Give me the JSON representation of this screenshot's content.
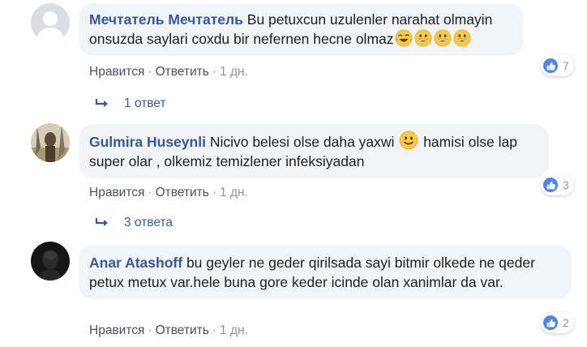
{
  "comments": [
    {
      "author": "Мечтатель Мечтатель",
      "text": "Bu petuxcun uzulenler narahat olmayin onsuzda saylari coxdu bir nefernen hecne olmaz",
      "emojis": [
        "tears-of-joy-emoji",
        "grinning-emoji",
        "grinning-emoji",
        "grinning-emoji"
      ],
      "actions": {
        "like": "Нравится",
        "reply": "Ответить",
        "time": "1 дн."
      },
      "reaction_count": "7",
      "replies_label": "1 ответ"
    },
    {
      "author": "Gulmira Huseynli",
      "text_before": "Nicivo belesi olse daha yaxwi",
      "text_after": "hamisi olse lap super olar , olkemiz temizlener infeksiyadan",
      "emoji": "slightly-smiling-emoji",
      "actions": {
        "like": "Нравится",
        "reply": "Ответить",
        "time": "1 дн."
      },
      "reaction_count": "3",
      "replies_label": "3 ответа"
    },
    {
      "author": "Anar Atashoff",
      "text": "bu geyler ne geder qirilsada sayi bitmir olkede ne qeder petux metux var.hele buna gore keder icinde olan xanimlar da var.",
      "actions": {
        "like": "Нравится",
        "reply": "Ответить",
        "time": "1 дн."
      },
      "reaction_count": "2"
    }
  ],
  "colors": {
    "author": "#385898",
    "bubble": "#f2f3f5",
    "like_badge": "#4e86e8",
    "meta": "#90949c"
  }
}
